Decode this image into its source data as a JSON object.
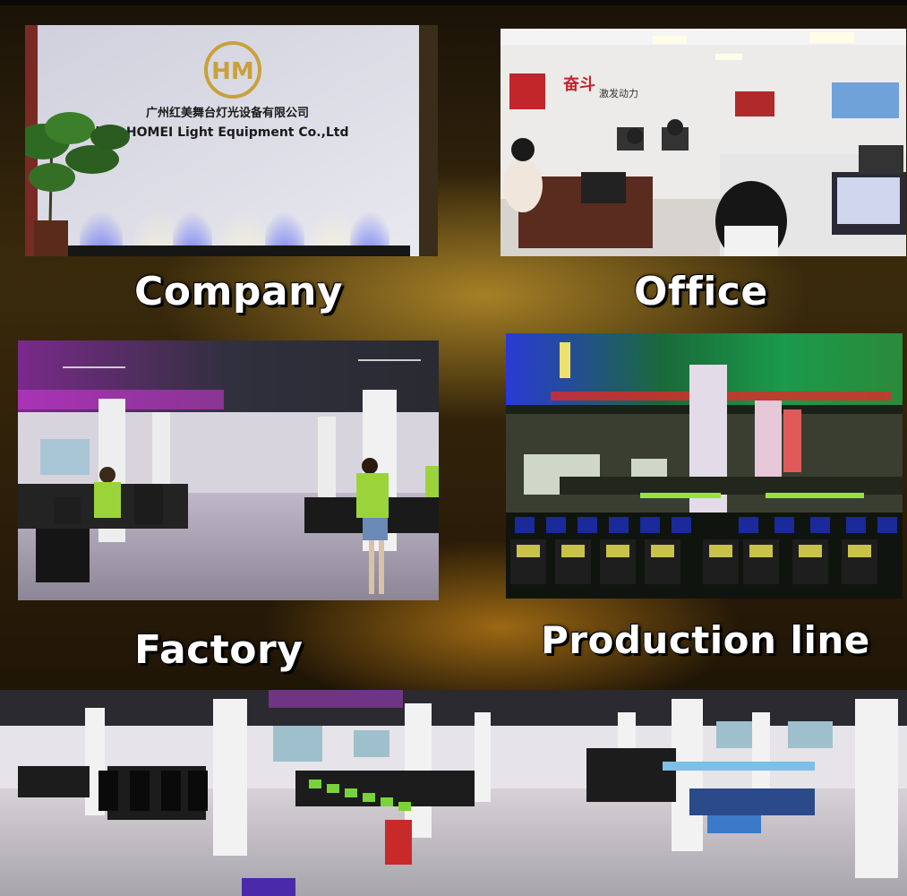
{
  "captions": {
    "company": "Company",
    "office": "Office",
    "factory": "Factory",
    "production_line": "Production line"
  },
  "company_photo": {
    "sign_chinese": "广州红美舞台灯光设备有限公司",
    "sign_english": "hou HOMEI Light Equipment Co.,Ltd",
    "logo_text": "HM"
  },
  "office_photo": {
    "wall_slogan": "奋斗",
    "wall_slogan_small": "激发动力"
  },
  "colors": {
    "gold": "#c9a03a",
    "background": "#2a1c08",
    "caption_text": "#ffffff"
  }
}
